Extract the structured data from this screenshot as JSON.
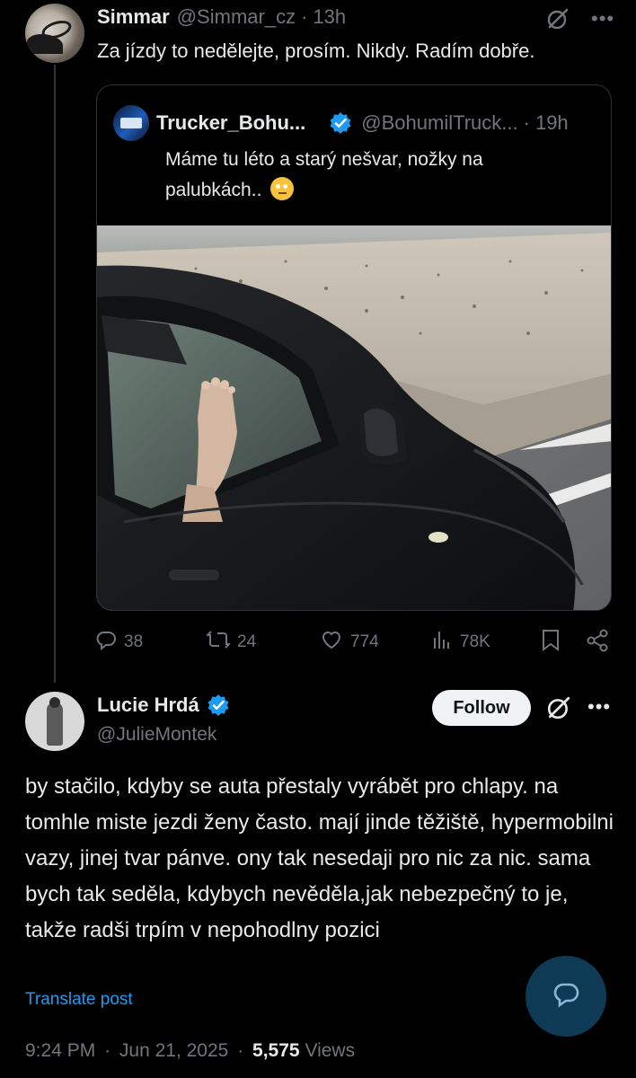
{
  "reply": {
    "name": "Simmar",
    "handle": "@Simmar_cz",
    "sep": "·",
    "time": "13h",
    "text": "Za jízdy to nedělejte, prosím. Nikdy. Radím dobře.",
    "quote": {
      "name": "Trucker_Bohu...",
      "handle": "@BohumilTruck...",
      "sep": "·",
      "time": "19h",
      "text": "Máme tu léto a starý nešvar, nožky na palubkách.."
    },
    "actions": {
      "replies": "38",
      "reposts": "24",
      "likes": "774",
      "views": "78K"
    }
  },
  "main": {
    "name": "Lucie Hrdá",
    "handle": "@JulieMontek",
    "follow_label": "Follow",
    "text": "by stačilo, kdyby se auta přestaly vyrábět pro chlapy. na tomhle miste jezdi ženy často. mají jinde těžiště, hypermobilni vazy,  jinej tvar pánve.  ony tak nesedaji pro nic za nic. sama bych tak seděla, kdybych nevěděla,jak nebezpečný to je, takže radši trpím v nepohodlny pozici",
    "translate_label": "Translate post",
    "time": "9:24 PM",
    "date": "Jun 21, 2025",
    "sep": "·",
    "views_count": "5,575",
    "views_label": "Views"
  },
  "colors": {
    "background": "#000000",
    "text": "#e7e9ea",
    "muted": "#71767b",
    "link": "#1d9bf0",
    "verified": "#1d9bf0"
  },
  "icons": [
    "grok-icon",
    "more-icon",
    "verified-icon",
    "reply-icon",
    "repost-icon",
    "like-icon",
    "views-icon",
    "bookmark-icon",
    "share-icon",
    "compose-icon"
  ]
}
